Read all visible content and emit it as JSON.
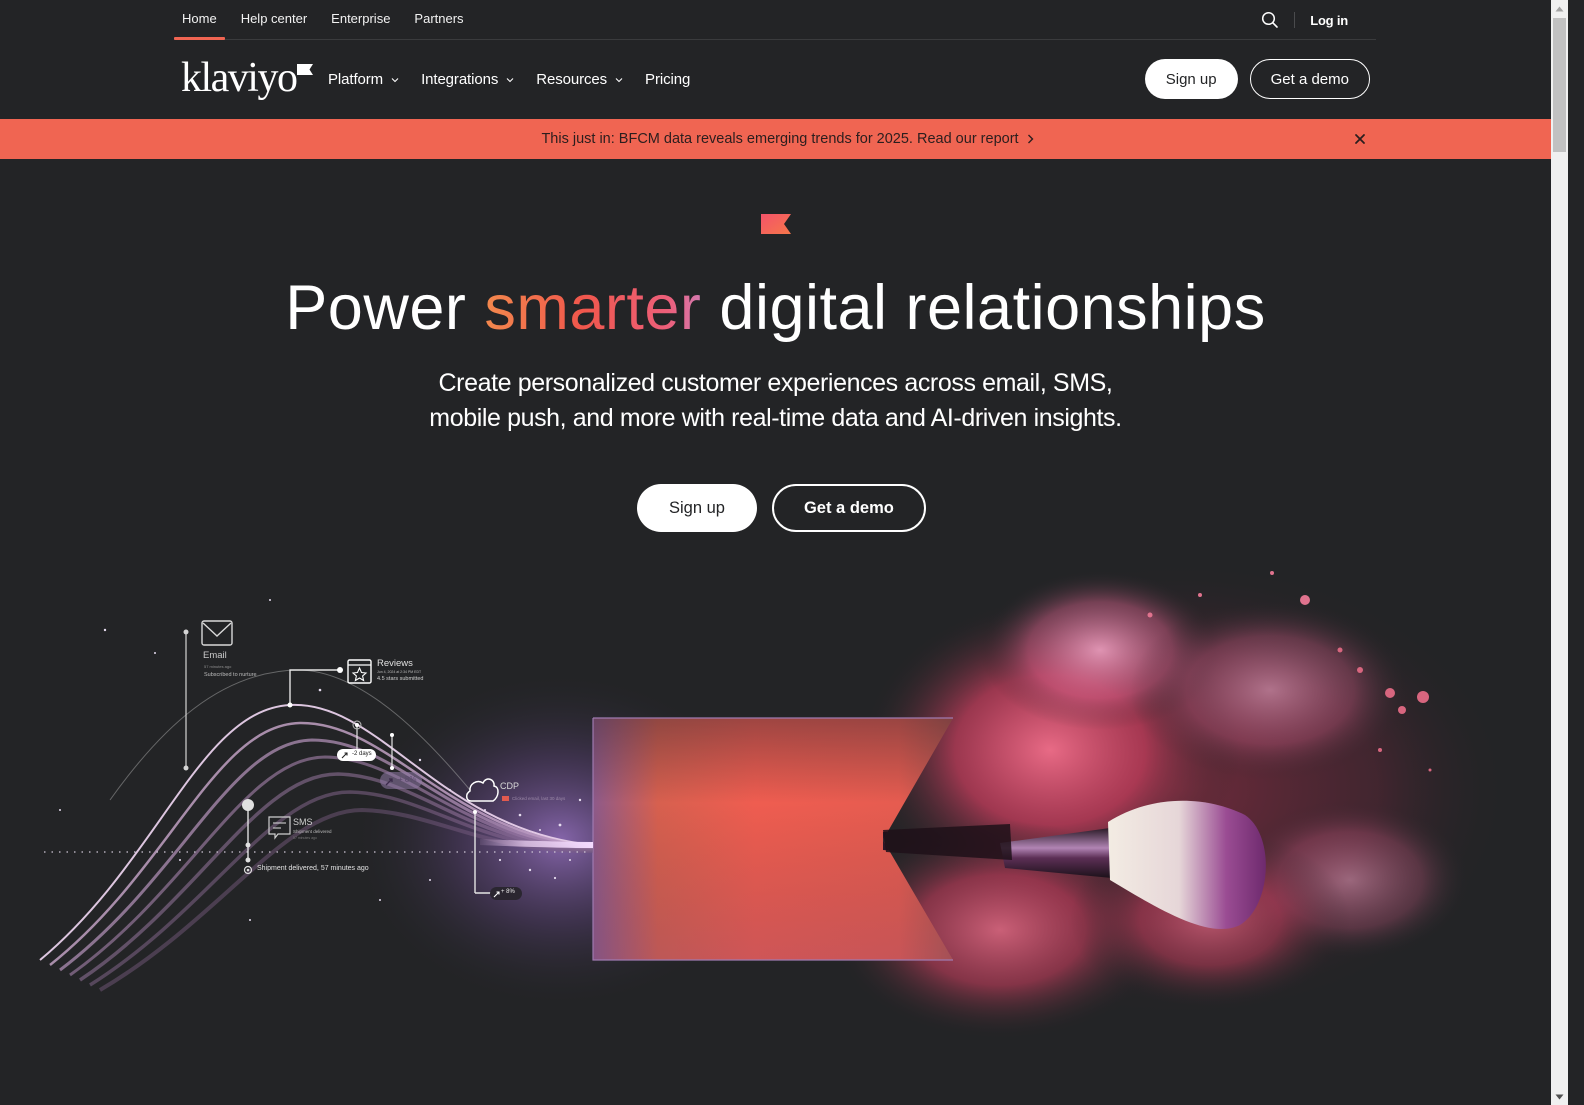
{
  "utility_nav": {
    "items": [
      {
        "label": "Home",
        "active": true
      },
      {
        "label": "Help center",
        "active": false
      },
      {
        "label": "Enterprise",
        "active": false
      },
      {
        "label": "Partners",
        "active": false
      }
    ],
    "search_icon": "search-icon",
    "login_label": "Log in"
  },
  "main_nav": {
    "logo_text": "klaviyo",
    "items": [
      {
        "label": "Platform",
        "has_dropdown": true
      },
      {
        "label": "Integrations",
        "has_dropdown": true
      },
      {
        "label": "Resources",
        "has_dropdown": true
      },
      {
        "label": "Pricing",
        "has_dropdown": false
      }
    ],
    "signup_label": "Sign up",
    "demo_label": "Get a demo"
  },
  "banner": {
    "text": "This just in: BFCM data reveals emerging trends for 2025. Read our report",
    "chevron_icon": "chevron-right-icon",
    "close_icon": "close-icon",
    "background": "#f06552"
  },
  "hero": {
    "headline_before": "Power",
    "headline_accent": "smarter",
    "headline_after": "digital relationships",
    "subheadline": "Create personalized customer experiences across email, SMS, mobile push, and more with real-time data and AI-driven insights.",
    "signup_label": "Sign up",
    "demo_label": "Get a demo"
  },
  "illustration": {
    "email": {
      "title": "Email",
      "time": "57 minutes ago",
      "detail": "Subscribed to nurture"
    },
    "reviews": {
      "title": "Reviews",
      "time": "Jun 4, 2024 at 2:34 PM EDT",
      "detail": "4.5 stars submitted"
    },
    "sms": {
      "title": "SMS",
      "detail": "Shipment delivered",
      "time": "57 minutes ago"
    },
    "shipment_event": "Shipment delivered, 57 minutes ago",
    "badge_days": "-2 days",
    "badge_pct_1": "+ 8%",
    "cdp": {
      "title": "CDP",
      "detail": "Clicked email, last 30 days"
    },
    "badge_pct_2": "+ 8%"
  },
  "colors": {
    "background": "#232426",
    "accent": "#f06552",
    "text": "#ffffff"
  }
}
